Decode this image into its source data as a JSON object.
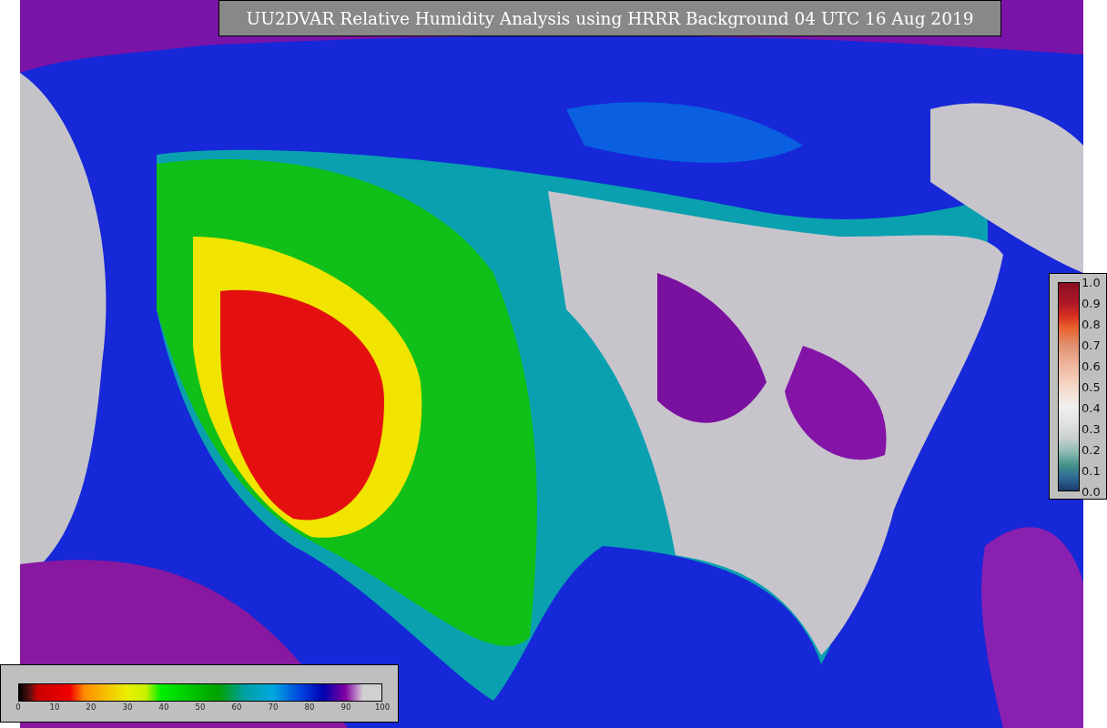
{
  "title": "UU2DVAR Relative Humidity Analysis using HRRR Background 04 UTC 16 Aug 2019",
  "humidity_colorbar": {
    "ticks": [
      "0",
      "10",
      "20",
      "30",
      "40",
      "50",
      "60",
      "70",
      "80",
      "90",
      "100"
    ]
  },
  "value_colorbar": {
    "ticks": [
      "1.0",
      "0.9",
      "0.8",
      "0.7",
      "0.6",
      "0.5",
      "0.4",
      "0.3",
      "0.2",
      "0.1",
      "0.0"
    ]
  }
}
